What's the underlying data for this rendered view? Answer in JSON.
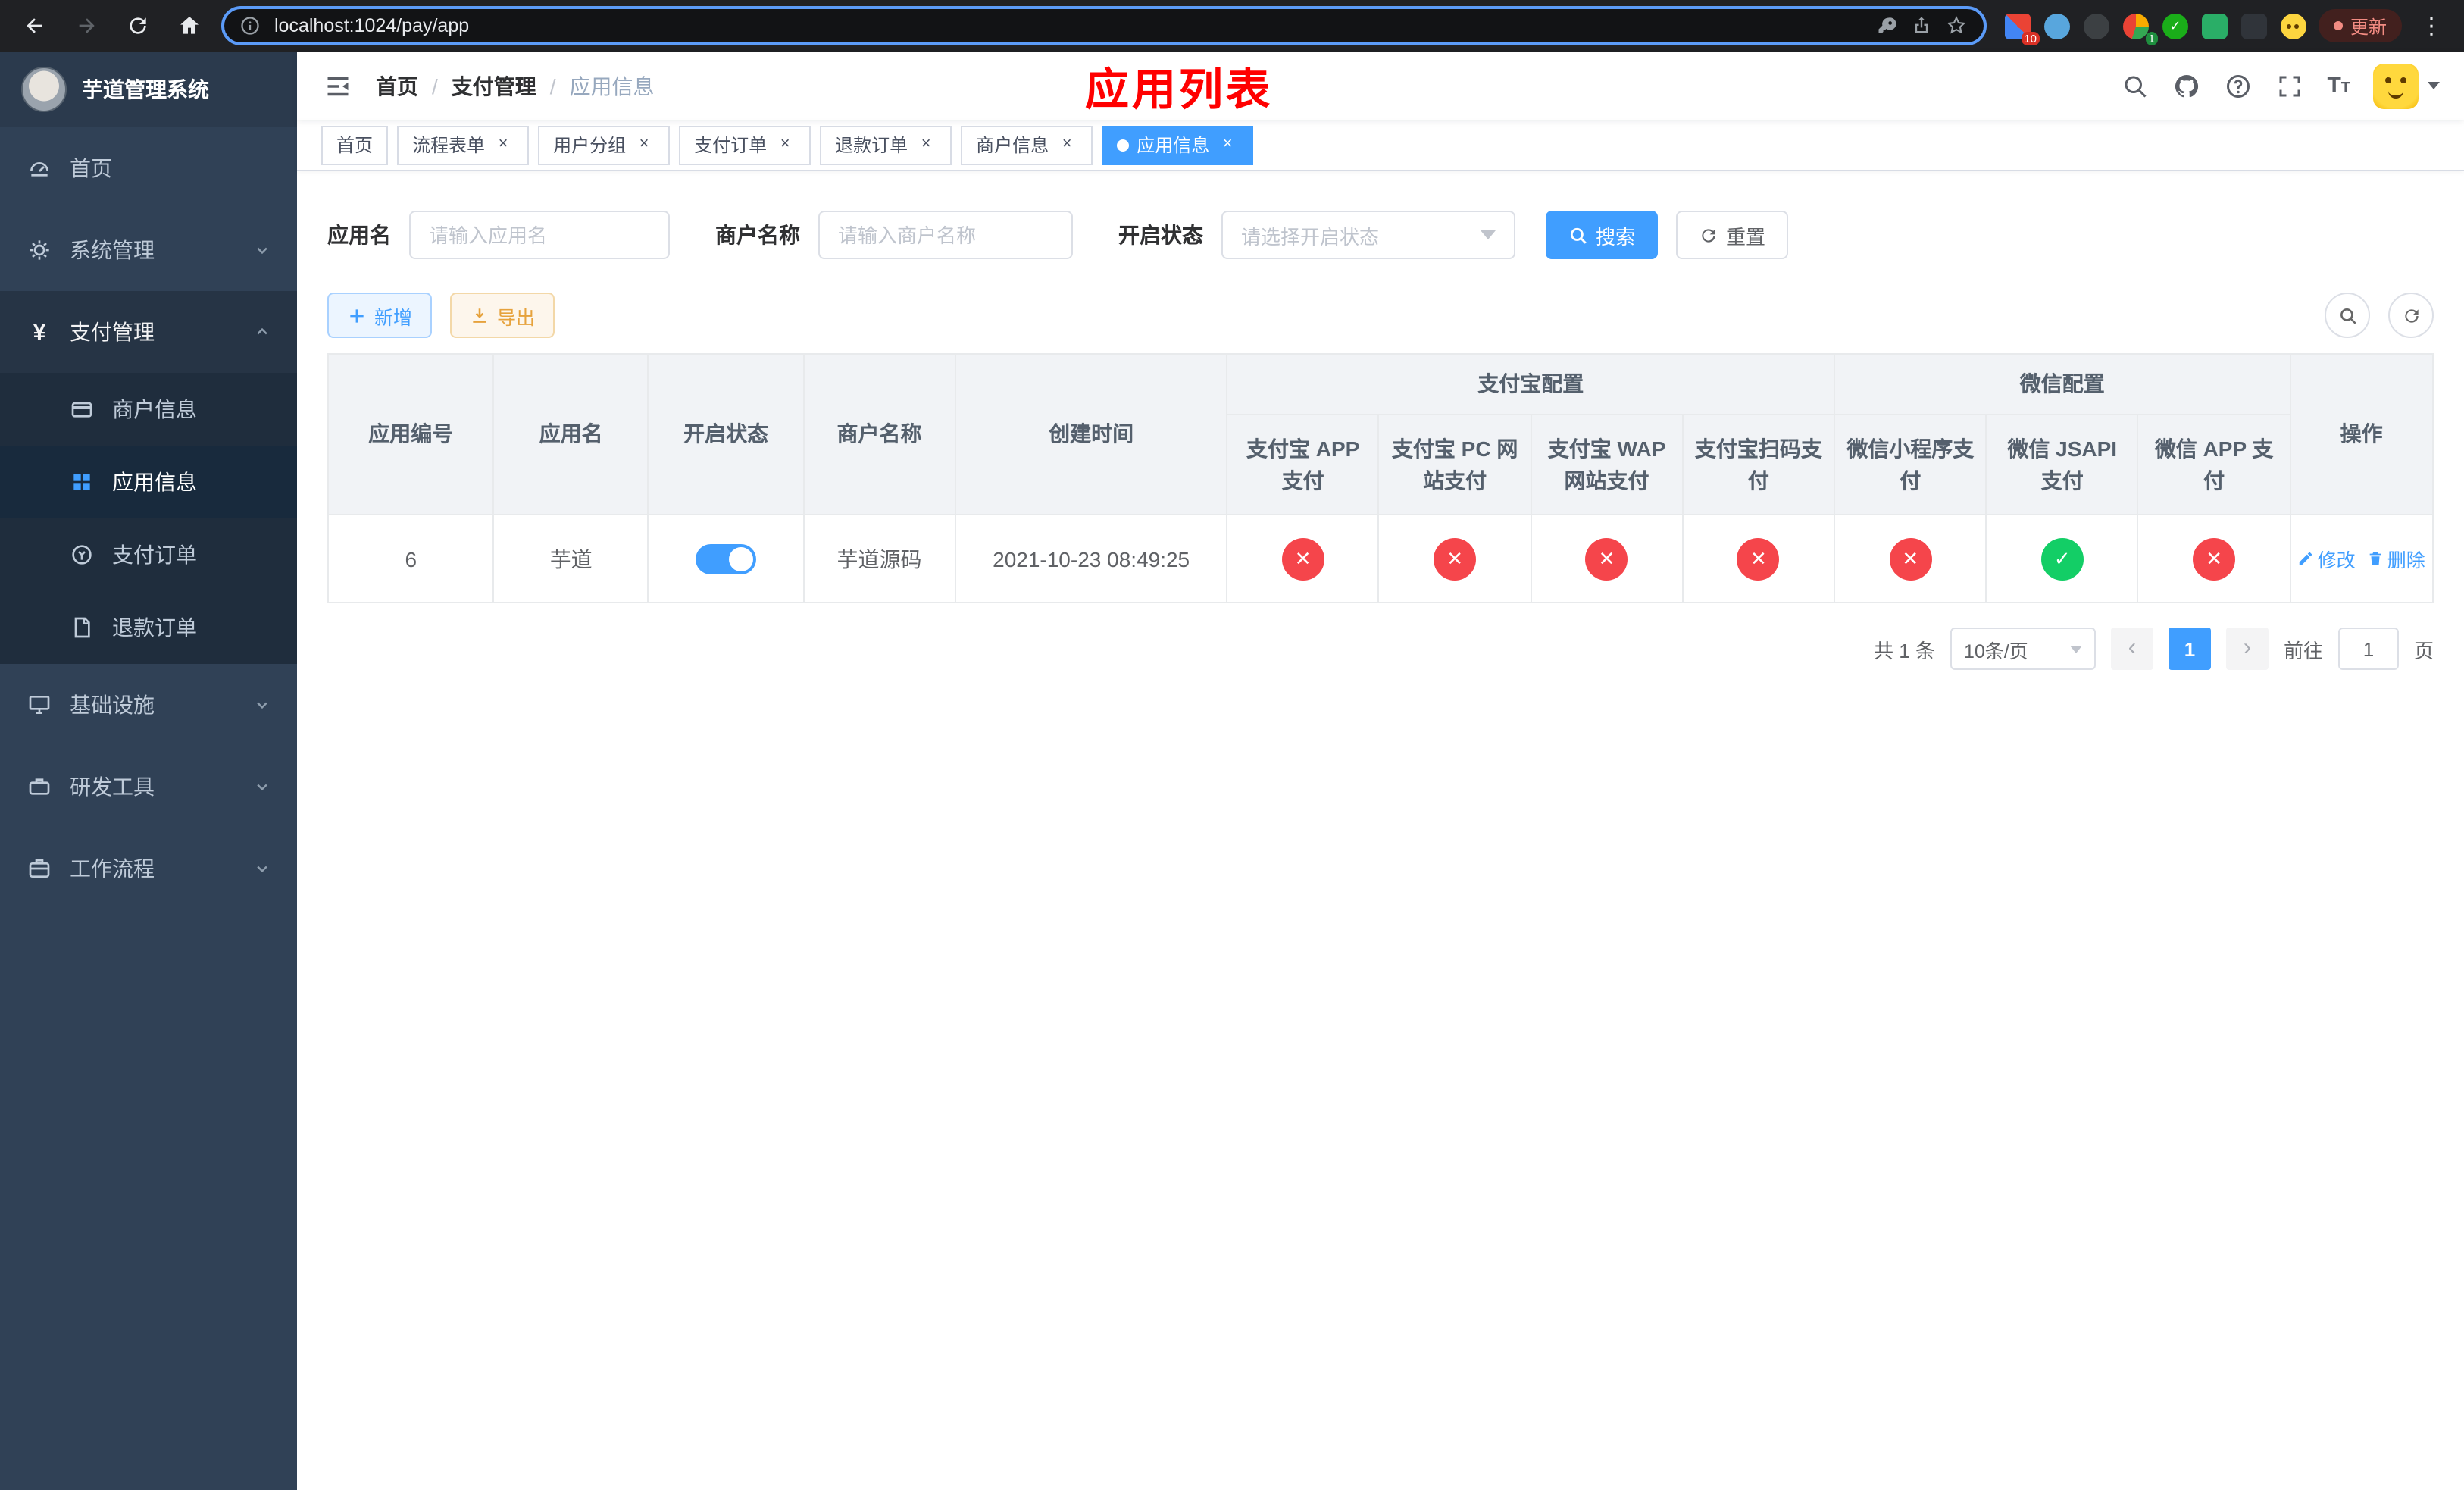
{
  "browser": {
    "url": "localhost:1024/pay/app",
    "update_label": "更新",
    "ext_badge_a": "10",
    "ext_badge_b": "1"
  },
  "sidebar": {
    "title": "芋道管理系统",
    "items": {
      "home": "首页",
      "system": "系统管理",
      "pay": "支付管理",
      "merchant": "商户信息",
      "app": "应用信息",
      "order": "支付订单",
      "refund": "退款订单",
      "infra": "基础设施",
      "tool": "研发工具",
      "workflow": "工作流程"
    }
  },
  "header": {
    "breadcrumb": [
      "首页",
      "支付管理",
      "应用信息"
    ],
    "annotation": "应用列表"
  },
  "tags": [
    {
      "label": "首页"
    },
    {
      "label": "流程表单"
    },
    {
      "label": "用户分组"
    },
    {
      "label": "支付订单"
    },
    {
      "label": "退款订单"
    },
    {
      "label": "商户信息"
    },
    {
      "label": "应用信息"
    }
  ],
  "filters": {
    "app_name_label": "应用名",
    "app_name_placeholder": "请输入应用名",
    "merchant_label": "商户名称",
    "merchant_placeholder": "请输入商户名称",
    "status_label": "开启状态",
    "status_placeholder": "请选择开启状态",
    "search_label": "搜索",
    "reset_label": "重置"
  },
  "toolbar": {
    "add_label": "新增",
    "export_label": "导出"
  },
  "table": {
    "headers": {
      "app_id": "应用编号",
      "app_name": "应用名",
      "status": "开启状态",
      "merchant": "商户名称",
      "create_time": "创建时间",
      "alipay_group": "支付宝配置",
      "wechat_group": "微信配置",
      "actions": "操作",
      "alipay_app": "支付宝 APP 支付",
      "alipay_pc": "支付宝 PC 网站支付",
      "alipay_wap": "支付宝 WAP 网站支付",
      "alipay_qr": "支付宝扫码支付",
      "wx_mini": "微信小程序支付",
      "wx_jsapi": "微信 JSAPI 支付",
      "wx_app": "微信 APP 支付"
    },
    "rows": [
      {
        "app_id": "6",
        "app_name": "芋道",
        "status_on": true,
        "merchant": "芋道源码",
        "create_time": "2021-10-23 08:49:25",
        "configs": [
          "x",
          "x",
          "x",
          "x",
          "x",
          "check",
          "x"
        ],
        "edit_label": "修改",
        "delete_label": "删除"
      }
    ]
  },
  "pagination": {
    "total_text": "共 1 条",
    "page_size": "10条/页",
    "current_page": "1",
    "goto_prefix": "前往",
    "goto_value": "1",
    "goto_suffix": "页"
  },
  "colors": {
    "accent": "#409eff",
    "danger": "#f5454b",
    "success": "#13ce66",
    "annotation": "#ff0000"
  }
}
